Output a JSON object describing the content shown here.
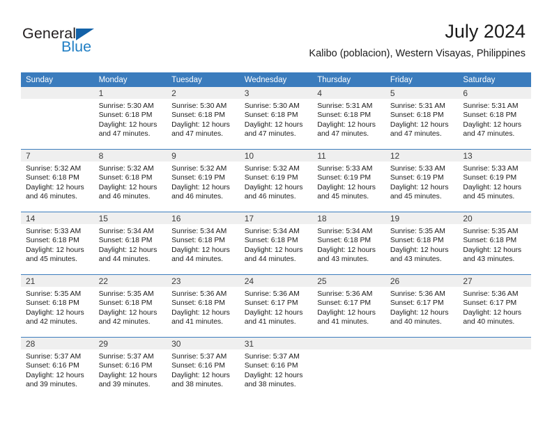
{
  "brand": {
    "name_part1": "General",
    "name_part2": "Blue",
    "triangle_color": "#1362a8",
    "blue_color": "#1f7ec4"
  },
  "header": {
    "month_title": "July 2024",
    "location": "Kalibo (poblacion), Western Visayas, Philippines"
  },
  "theme": {
    "header_row_bg": "#3b7cbd",
    "daynum_bg": "#efefef",
    "grid_line": "#3b7cbd"
  },
  "calendar": {
    "weekday_headers": [
      "Sunday",
      "Monday",
      "Tuesday",
      "Wednesday",
      "Thursday",
      "Friday",
      "Saturday"
    ],
    "weeks": [
      [
        {
          "day": "",
          "lines": []
        },
        {
          "day": "1",
          "lines": [
            "Sunrise: 5:30 AM",
            "Sunset: 6:18 PM",
            "Daylight: 12 hours",
            "and 47 minutes."
          ]
        },
        {
          "day": "2",
          "lines": [
            "Sunrise: 5:30 AM",
            "Sunset: 6:18 PM",
            "Daylight: 12 hours",
            "and 47 minutes."
          ]
        },
        {
          "day": "3",
          "lines": [
            "Sunrise: 5:30 AM",
            "Sunset: 6:18 PM",
            "Daylight: 12 hours",
            "and 47 minutes."
          ]
        },
        {
          "day": "4",
          "lines": [
            "Sunrise: 5:31 AM",
            "Sunset: 6:18 PM",
            "Daylight: 12 hours",
            "and 47 minutes."
          ]
        },
        {
          "day": "5",
          "lines": [
            "Sunrise: 5:31 AM",
            "Sunset: 6:18 PM",
            "Daylight: 12 hours",
            "and 47 minutes."
          ]
        },
        {
          "day": "6",
          "lines": [
            "Sunrise: 5:31 AM",
            "Sunset: 6:18 PM",
            "Daylight: 12 hours",
            "and 47 minutes."
          ]
        }
      ],
      [
        {
          "day": "7",
          "lines": [
            "Sunrise: 5:32 AM",
            "Sunset: 6:18 PM",
            "Daylight: 12 hours",
            "and 46 minutes."
          ]
        },
        {
          "day": "8",
          "lines": [
            "Sunrise: 5:32 AM",
            "Sunset: 6:18 PM",
            "Daylight: 12 hours",
            "and 46 minutes."
          ]
        },
        {
          "day": "9",
          "lines": [
            "Sunrise: 5:32 AM",
            "Sunset: 6:19 PM",
            "Daylight: 12 hours",
            "and 46 minutes."
          ]
        },
        {
          "day": "10",
          "lines": [
            "Sunrise: 5:32 AM",
            "Sunset: 6:19 PM",
            "Daylight: 12 hours",
            "and 46 minutes."
          ]
        },
        {
          "day": "11",
          "lines": [
            "Sunrise: 5:33 AM",
            "Sunset: 6:19 PM",
            "Daylight: 12 hours",
            "and 45 minutes."
          ]
        },
        {
          "day": "12",
          "lines": [
            "Sunrise: 5:33 AM",
            "Sunset: 6:19 PM",
            "Daylight: 12 hours",
            "and 45 minutes."
          ]
        },
        {
          "day": "13",
          "lines": [
            "Sunrise: 5:33 AM",
            "Sunset: 6:19 PM",
            "Daylight: 12 hours",
            "and 45 minutes."
          ]
        }
      ],
      [
        {
          "day": "14",
          "lines": [
            "Sunrise: 5:33 AM",
            "Sunset: 6:18 PM",
            "Daylight: 12 hours",
            "and 45 minutes."
          ]
        },
        {
          "day": "15",
          "lines": [
            "Sunrise: 5:34 AM",
            "Sunset: 6:18 PM",
            "Daylight: 12 hours",
            "and 44 minutes."
          ]
        },
        {
          "day": "16",
          "lines": [
            "Sunrise: 5:34 AM",
            "Sunset: 6:18 PM",
            "Daylight: 12 hours",
            "and 44 minutes."
          ]
        },
        {
          "day": "17",
          "lines": [
            "Sunrise: 5:34 AM",
            "Sunset: 6:18 PM",
            "Daylight: 12 hours",
            "and 44 minutes."
          ]
        },
        {
          "day": "18",
          "lines": [
            "Sunrise: 5:34 AM",
            "Sunset: 6:18 PM",
            "Daylight: 12 hours",
            "and 43 minutes."
          ]
        },
        {
          "day": "19",
          "lines": [
            "Sunrise: 5:35 AM",
            "Sunset: 6:18 PM",
            "Daylight: 12 hours",
            "and 43 minutes."
          ]
        },
        {
          "day": "20",
          "lines": [
            "Sunrise: 5:35 AM",
            "Sunset: 6:18 PM",
            "Daylight: 12 hours",
            "and 43 minutes."
          ]
        }
      ],
      [
        {
          "day": "21",
          "lines": [
            "Sunrise: 5:35 AM",
            "Sunset: 6:18 PM",
            "Daylight: 12 hours",
            "and 42 minutes."
          ]
        },
        {
          "day": "22",
          "lines": [
            "Sunrise: 5:35 AM",
            "Sunset: 6:18 PM",
            "Daylight: 12 hours",
            "and 42 minutes."
          ]
        },
        {
          "day": "23",
          "lines": [
            "Sunrise: 5:36 AM",
            "Sunset: 6:18 PM",
            "Daylight: 12 hours",
            "and 41 minutes."
          ]
        },
        {
          "day": "24",
          "lines": [
            "Sunrise: 5:36 AM",
            "Sunset: 6:17 PM",
            "Daylight: 12 hours",
            "and 41 minutes."
          ]
        },
        {
          "day": "25",
          "lines": [
            "Sunrise: 5:36 AM",
            "Sunset: 6:17 PM",
            "Daylight: 12 hours",
            "and 41 minutes."
          ]
        },
        {
          "day": "26",
          "lines": [
            "Sunrise: 5:36 AM",
            "Sunset: 6:17 PM",
            "Daylight: 12 hours",
            "and 40 minutes."
          ]
        },
        {
          "day": "27",
          "lines": [
            "Sunrise: 5:36 AM",
            "Sunset: 6:17 PM",
            "Daylight: 12 hours",
            "and 40 minutes."
          ]
        }
      ],
      [
        {
          "day": "28",
          "lines": [
            "Sunrise: 5:37 AM",
            "Sunset: 6:16 PM",
            "Daylight: 12 hours",
            "and 39 minutes."
          ]
        },
        {
          "day": "29",
          "lines": [
            "Sunrise: 5:37 AM",
            "Sunset: 6:16 PM",
            "Daylight: 12 hours",
            "and 39 minutes."
          ]
        },
        {
          "day": "30",
          "lines": [
            "Sunrise: 5:37 AM",
            "Sunset: 6:16 PM",
            "Daylight: 12 hours",
            "and 38 minutes."
          ]
        },
        {
          "day": "31",
          "lines": [
            "Sunrise: 5:37 AM",
            "Sunset: 6:16 PM",
            "Daylight: 12 hours",
            "and 38 minutes."
          ]
        },
        {
          "day": "",
          "lines": []
        },
        {
          "day": "",
          "lines": []
        },
        {
          "day": "",
          "lines": []
        }
      ]
    ]
  }
}
